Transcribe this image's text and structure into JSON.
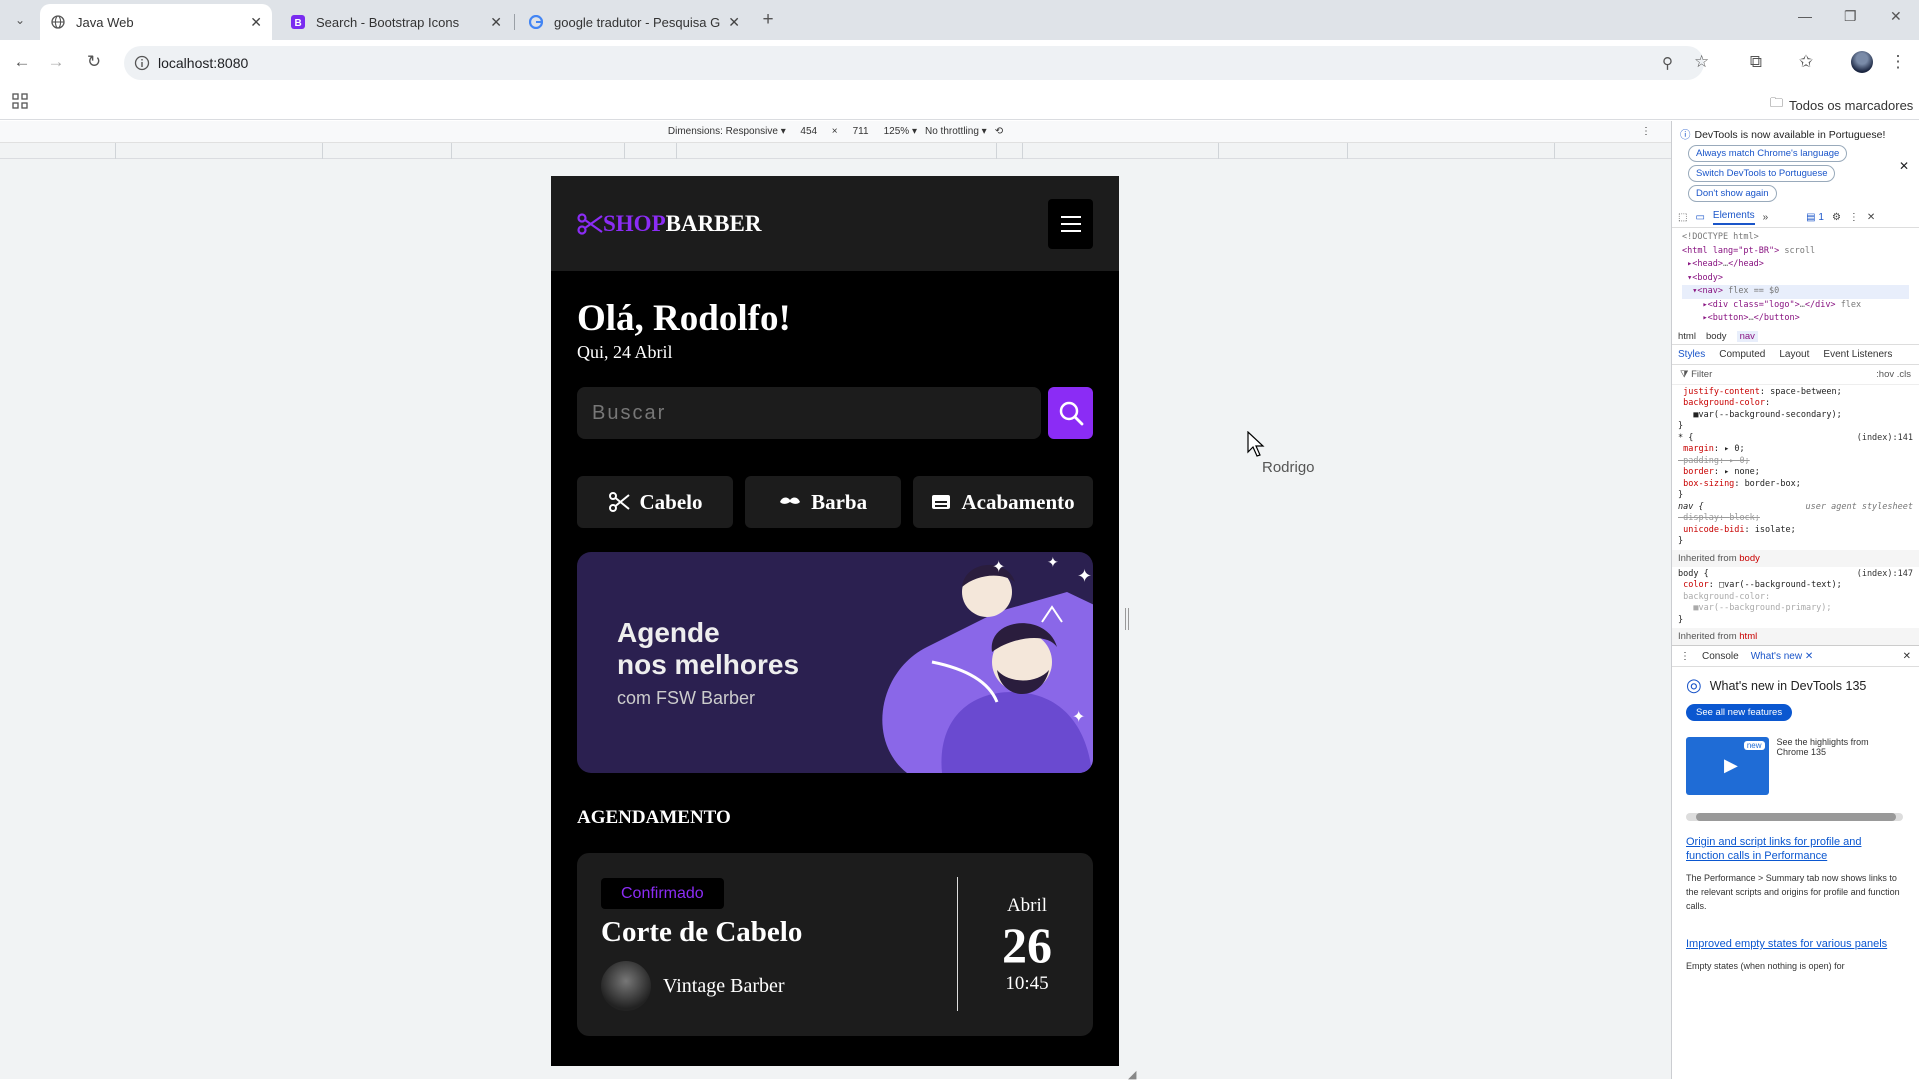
{
  "browser": {
    "tabs": [
      {
        "title": "Java Web",
        "icon": "globe-icon"
      },
      {
        "title": "Search - Bootstrap Icons",
        "icon": "bootstrap-icon"
      },
      {
        "title": "google tradutor - Pesquisa Goo",
        "icon": "google-icon"
      }
    ],
    "new_tab": "+",
    "url": "localhost:8080",
    "bookmarks_label": "Todos os marcadores"
  },
  "device_toolbar": {
    "dimensions_label": "Dimensions: Responsive",
    "width": "454",
    "times": "×",
    "height": "711",
    "zoom": "125%",
    "throttle": "No throttling"
  },
  "app": {
    "logo_shop": "SHOP",
    "logo_barber": "BARBER",
    "greeting": "Olá, Rodolfo!",
    "date": "Qui, 24 Abril",
    "search_placeholder": "Buscar",
    "categories": [
      {
        "label": "Cabelo",
        "icon": "scissors-icon"
      },
      {
        "label": "Barba",
        "icon": "mustache-icon"
      },
      {
        "label": "Acabamento",
        "icon": "towel-icon"
      }
    ],
    "banner": {
      "line1": "Agende",
      "line2": "nos melhores",
      "line3": "com FSW Barber"
    },
    "section_title": "AGENDAMENTO",
    "booking": {
      "status": "Confirmado",
      "service": "Corte de Cabelo",
      "shop": "Vintage Barber",
      "month": "Abril",
      "day": "26",
      "time": "10:45"
    }
  },
  "cursor_tooltip": "Rodrigo",
  "devtools": {
    "info_message": "DevTools is now available in Portuguese!",
    "info_buttons": [
      "Always match Chrome's language",
      "Switch DevTools to Portuguese",
      "Don't show again"
    ],
    "main_tab": "Elements",
    "issues_count": "1",
    "dom_lines": [
      "<!DOCTYPE html>",
      "<html lang=\"pt-BR\">",
      "<head>",
      "</head>",
      "<body>",
      "<nav>",
      "== $0",
      "<div class=\"logo\">",
      "</div>",
      "<button>",
      "</button>"
    ],
    "dom_badges": [
      "scroll",
      "flex",
      "flex"
    ],
    "breadcrumb": [
      "html",
      "body",
      "nav"
    ],
    "style_tabs": [
      "Styles",
      "Computed",
      "Layout",
      "Event Listeners"
    ],
    "filter_placeholder": "Filter",
    "filter_tools": ":hov .cls",
    "css_lines": [
      {
        "prop": "justify-content",
        "val": "space-between;"
      },
      {
        "prop": "background-color",
        "val": ""
      },
      {
        "prop": "",
        "val": "var(--background-secondary);"
      }
    ],
    "rule_star": {
      "selector": "* {",
      "src": "(index):141",
      "props": [
        [
          "margin",
          "0;"
        ],
        [
          "padding",
          "0;"
        ],
        [
          "border",
          "none;"
        ],
        [
          "box-sizing",
          "border-box;"
        ]
      ]
    },
    "rule_nav": {
      "selector": "nav {",
      "src": "user agent stylesheet",
      "props": [
        [
          "display",
          "block;"
        ],
        [
          "unicode-bidi",
          "isolate;"
        ]
      ]
    },
    "inherited_body": "Inherited from",
    "inherited_body_tag": "body",
    "rule_body": {
      "selector": "body {",
      "src": "(index):147",
      "props": [
        [
          "color",
          "var(--background-text);"
        ],
        [
          "background-color",
          ""
        ],
        [
          "",
          "var(--background-primary);"
        ]
      ]
    },
    "inherited_html_tag": "html",
    "drawer_tabs": [
      "Console",
      "What's new"
    ],
    "whats_new_title": "What's new in DevTools 135",
    "see_all": "See all new features",
    "new_badge": "new",
    "highlights": "See the highlights from Chrome 135",
    "article1_title": "Origin and script links for profile and function calls in Performance",
    "article1_body": "The Performance > Summary tab now shows links to the relevant scripts and origins for profile and function calls.",
    "article2_title": "Improved empty states for various panels",
    "article2_body": "Empty states (when nothing is open) for"
  },
  "colors": {
    "accent": "#8b2cf5",
    "app_bg": "#000000",
    "card_bg": "#1c1c1c",
    "banner_bg": "#2b2050"
  }
}
